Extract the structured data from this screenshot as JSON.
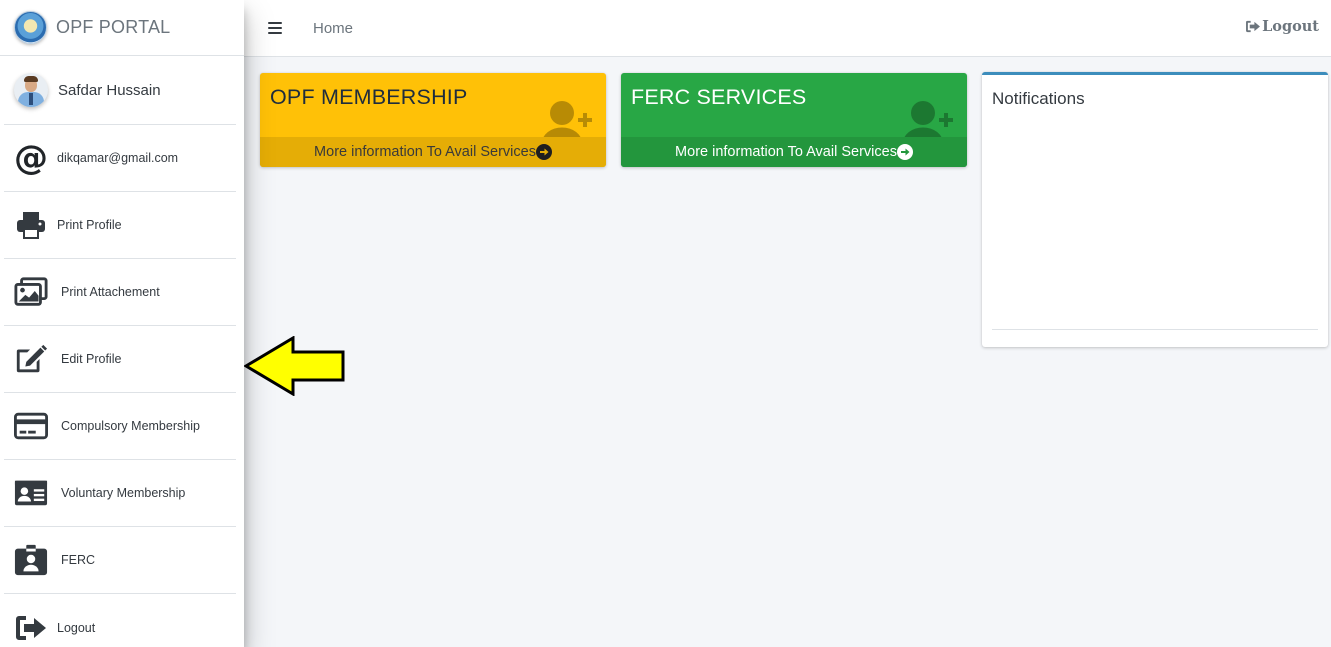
{
  "brand": {
    "title": "OPF PORTAL"
  },
  "user": {
    "name": "Safdar Hussain"
  },
  "sidebar": {
    "items": [
      {
        "label": "dikqamar@gmail.com",
        "icon": "at-icon"
      },
      {
        "label": "Print Profile",
        "icon": "print-icon"
      },
      {
        "label": "Print Attachement",
        "icon": "images-icon"
      },
      {
        "label": "Edit Profile",
        "icon": "edit-icon"
      },
      {
        "label": "Compulsory Membership",
        "icon": "credit-card-icon"
      },
      {
        "label": "Voluntary Membership",
        "icon": "id-card-icon"
      },
      {
        "label": "FERC",
        "icon": "id-badge-icon"
      },
      {
        "label": "Logout",
        "icon": "sign-out-icon"
      }
    ]
  },
  "topbar": {
    "home": "Home",
    "logout": "Logout"
  },
  "boxes": [
    {
      "title": "OPF MEMBERSHIP",
      "footer": "More information To Avail Services",
      "color": "#ffc107"
    },
    {
      "title": "FERC SERVICES",
      "footer": "More information To Avail Services",
      "color": "#28a745"
    }
  ],
  "notifications": {
    "title": "Notifications"
  },
  "colors": {
    "accent": "#3c8dbc",
    "arrow": "#ffff00"
  }
}
